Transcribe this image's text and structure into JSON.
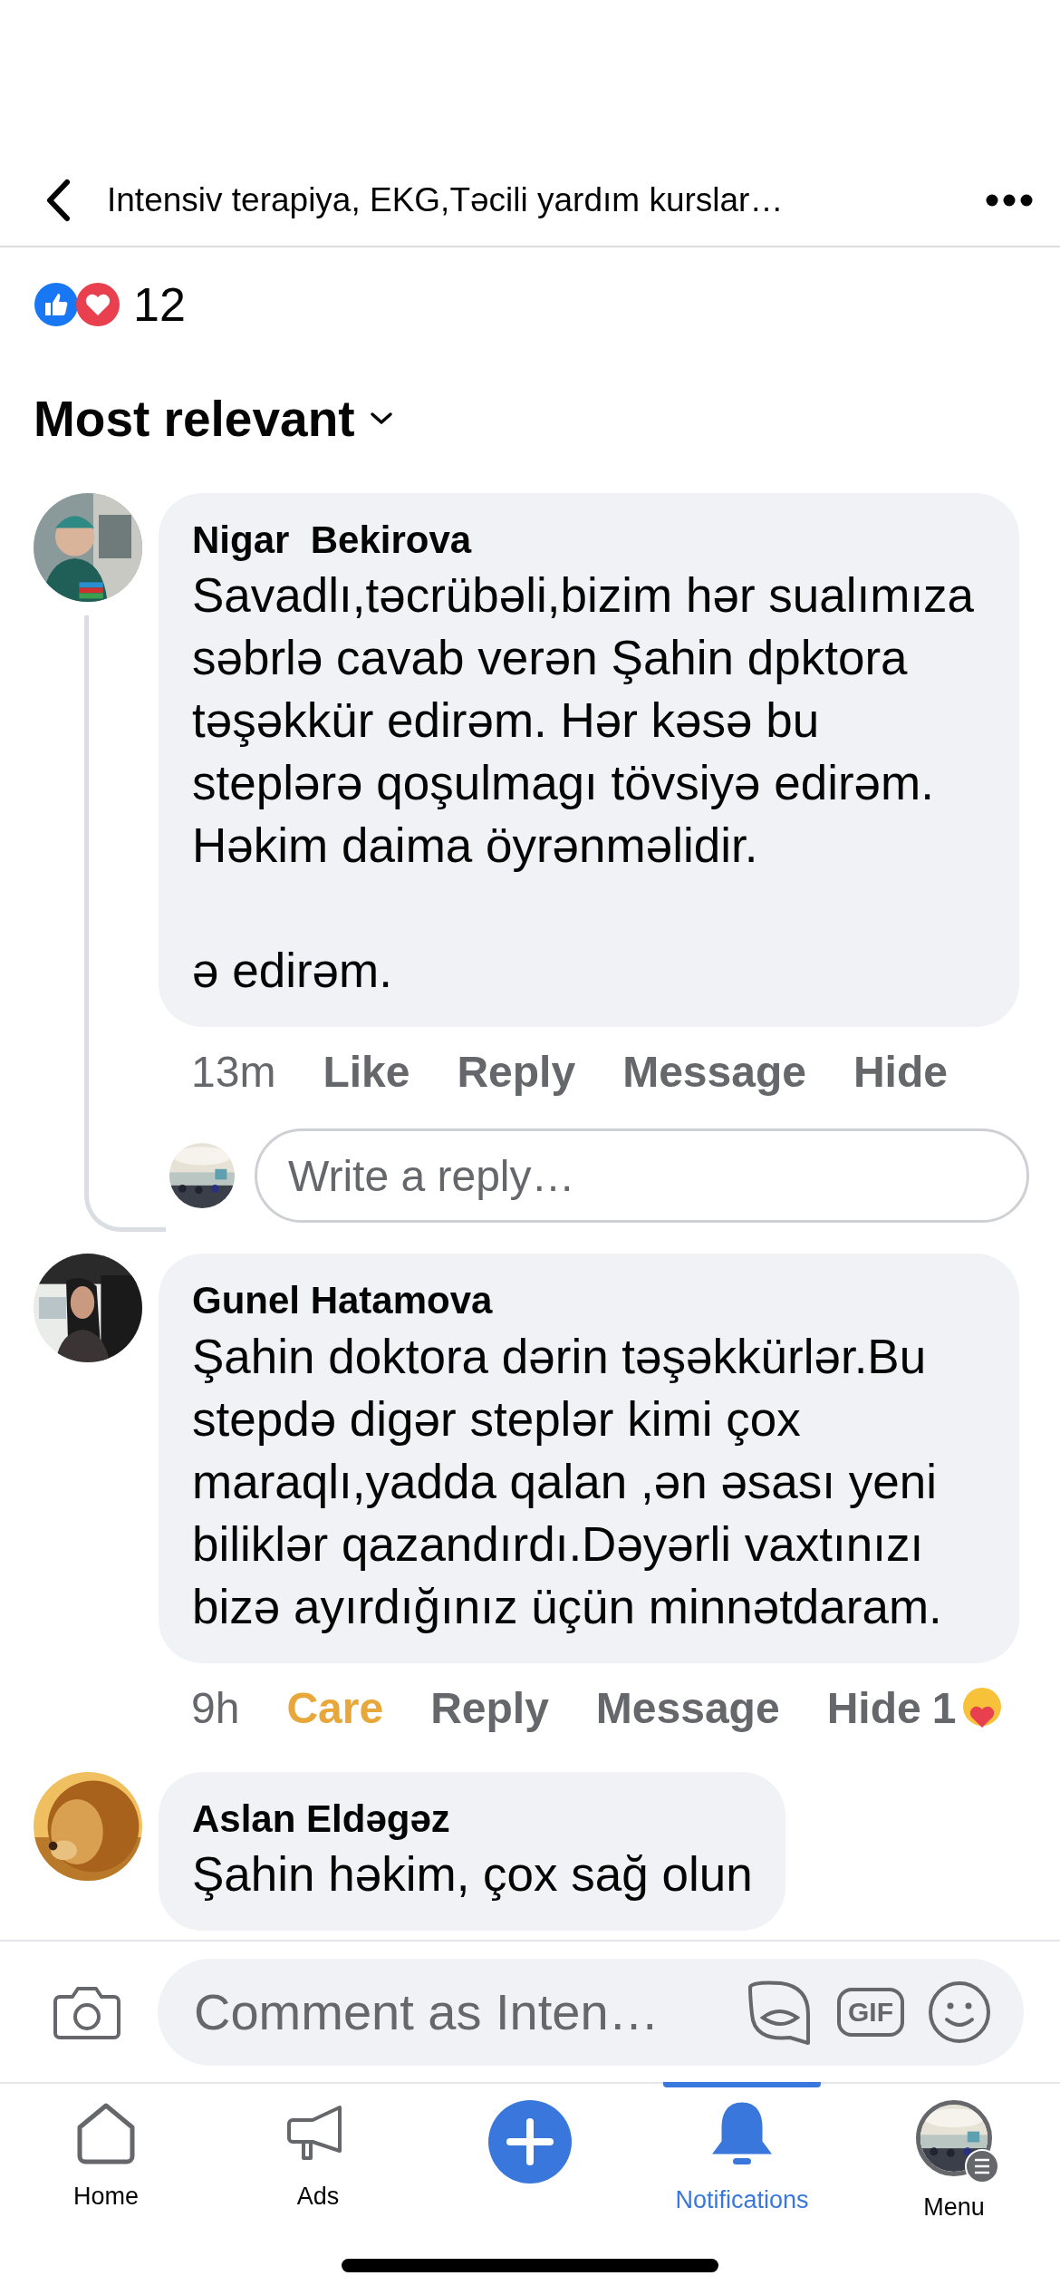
{
  "header": {
    "title": "Intensiv terapiya, EKG,Təcili yardım kurslar…"
  },
  "reactions": {
    "count": "12"
  },
  "sort": {
    "label": "Most relevant"
  },
  "comments": [
    {
      "author": "Nigar  Bekirova",
      "text": "Savadlı,təcrübəli,bizim hər sualımıza səbrlə cavab verən Şahin dpktora təşəkkür edirəm. Hər kəsə bu steplərə qoşulmagı tövsiyə edirəm. Həkim daima öyrənməlidir.\n\nə edirəm.",
      "time": "13m",
      "reaction": {
        "label": "Like",
        "kind": "none"
      },
      "actions": [
        "Reply",
        "Message",
        "Hide"
      ],
      "reply_field": {
        "placeholder": "Write a reply…"
      }
    },
    {
      "author": "Gunel Hatamova",
      "text": "Şahin doktora dərin təşəkkürlər.Bu stepdə digər steplər kimi çox maraqlı,yadda qalan ,ən əsası yeni biliklər qazandırdı.Dəyərli vaxtınızı bizə ayırdığınız üçün minnətdaram.",
      "time": "9h",
      "reaction": {
        "label": "Care",
        "kind": "care"
      },
      "actions": [
        "Reply",
        "Message",
        "Hide"
      ],
      "reaction_count": "1"
    },
    {
      "author": "Aslan Eldəgəz",
      "text": "Şahin həkim, çox sağ olun"
    }
  ],
  "comment_bar": {
    "placeholder": "Comment as Inten…",
    "gif_label": "GIF"
  },
  "nav": [
    {
      "kind": "home",
      "label": "Home",
      "selected": false
    },
    {
      "kind": "ads",
      "label": "Ads",
      "selected": false
    },
    {
      "kind": "create",
      "selected": false
    },
    {
      "kind": "notifications",
      "label": "Notifications",
      "selected": true
    },
    {
      "kind": "menu",
      "label": "Menu",
      "selected": false
    }
  ]
}
